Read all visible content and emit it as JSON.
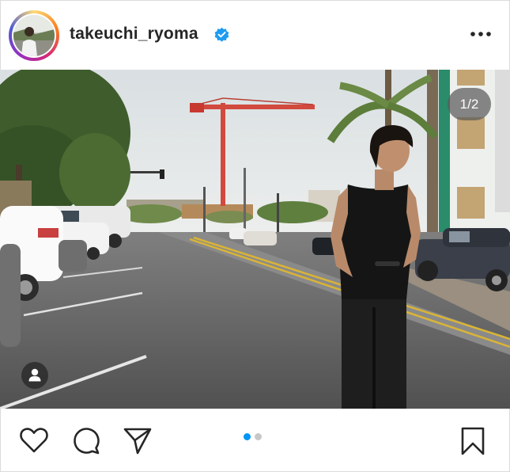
{
  "post": {
    "username": "takeuchi_ryoma",
    "verified": true,
    "carousel_counter": "1/2",
    "current_slide": 1,
    "total_slides": 2
  },
  "icons": {
    "verified": "verified-badge-icon",
    "more": "more-options-icon",
    "user_tag": "user-tag-icon",
    "like": "heart-icon",
    "comment": "comment-bubble-icon",
    "share": "paper-plane-icon",
    "save": "bookmark-icon"
  },
  "colors": {
    "verified_blue": "#1d9bf0",
    "active_dot": "#0095f6",
    "inactive_dot": "#c7c7c7",
    "text": "#262626"
  }
}
